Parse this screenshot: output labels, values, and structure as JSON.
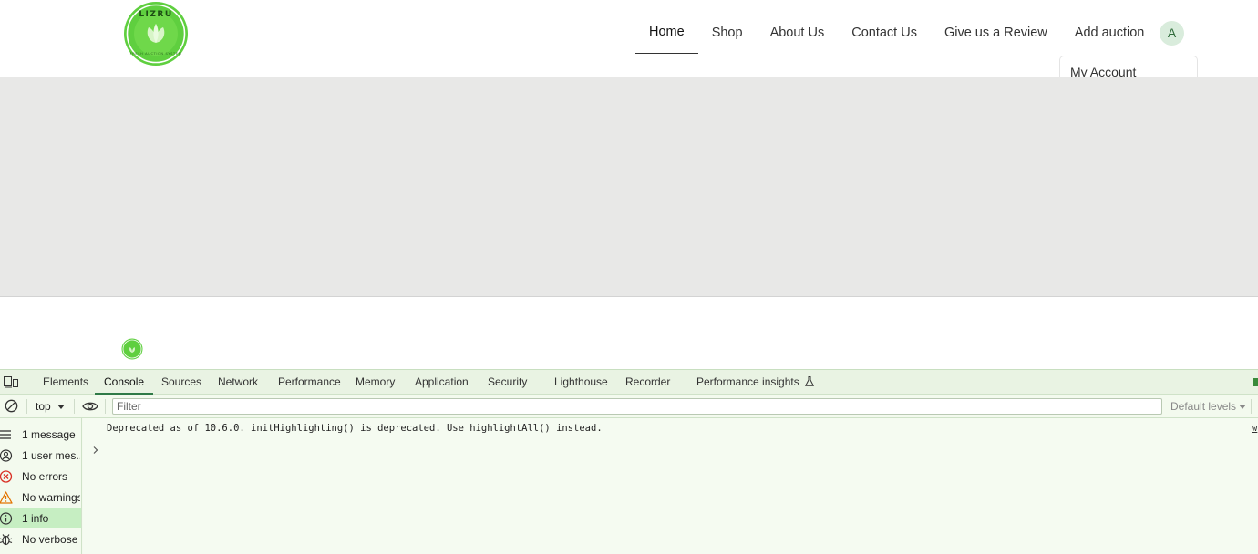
{
  "site": {
    "logo_alt": "LIZRU",
    "nav": {
      "home": "Home",
      "shop": "Shop",
      "about": "About Us",
      "contact": "Contact Us",
      "review": "Give us a Review",
      "add_auction": "Add auction"
    },
    "avatar_initial": "A",
    "account_menu": {
      "my_account": "My Account"
    }
  },
  "devtools": {
    "tabs": {
      "elements": "Elements",
      "console": "Console",
      "sources": "Sources",
      "network": "Network",
      "performance": "Performance",
      "memory": "Memory",
      "application": "Application",
      "security": "Security",
      "lighthouse": "Lighthouse",
      "recorder": "Recorder",
      "performance_insights": "Performance insights"
    },
    "toolbar": {
      "context": "top",
      "filter_placeholder": "Filter",
      "levels": "Default levels"
    },
    "sidebar": {
      "messages": "1 message",
      "user_messages": "1 user mes...",
      "errors": "No errors",
      "warnings": "No warnings",
      "info": "1 info",
      "verbose": "No verbose"
    },
    "console": {
      "message": "Deprecated as of 10.6.0. initHighlighting() is deprecated.  Use highlightAll() instead.",
      "source": "w"
    }
  },
  "colors": {
    "brand_green": "#6fd64a",
    "devtools_bg": "#f3faee",
    "selected_filter": "#c6eec2",
    "error_red": "#d93025",
    "warning_orange": "#e37400"
  }
}
